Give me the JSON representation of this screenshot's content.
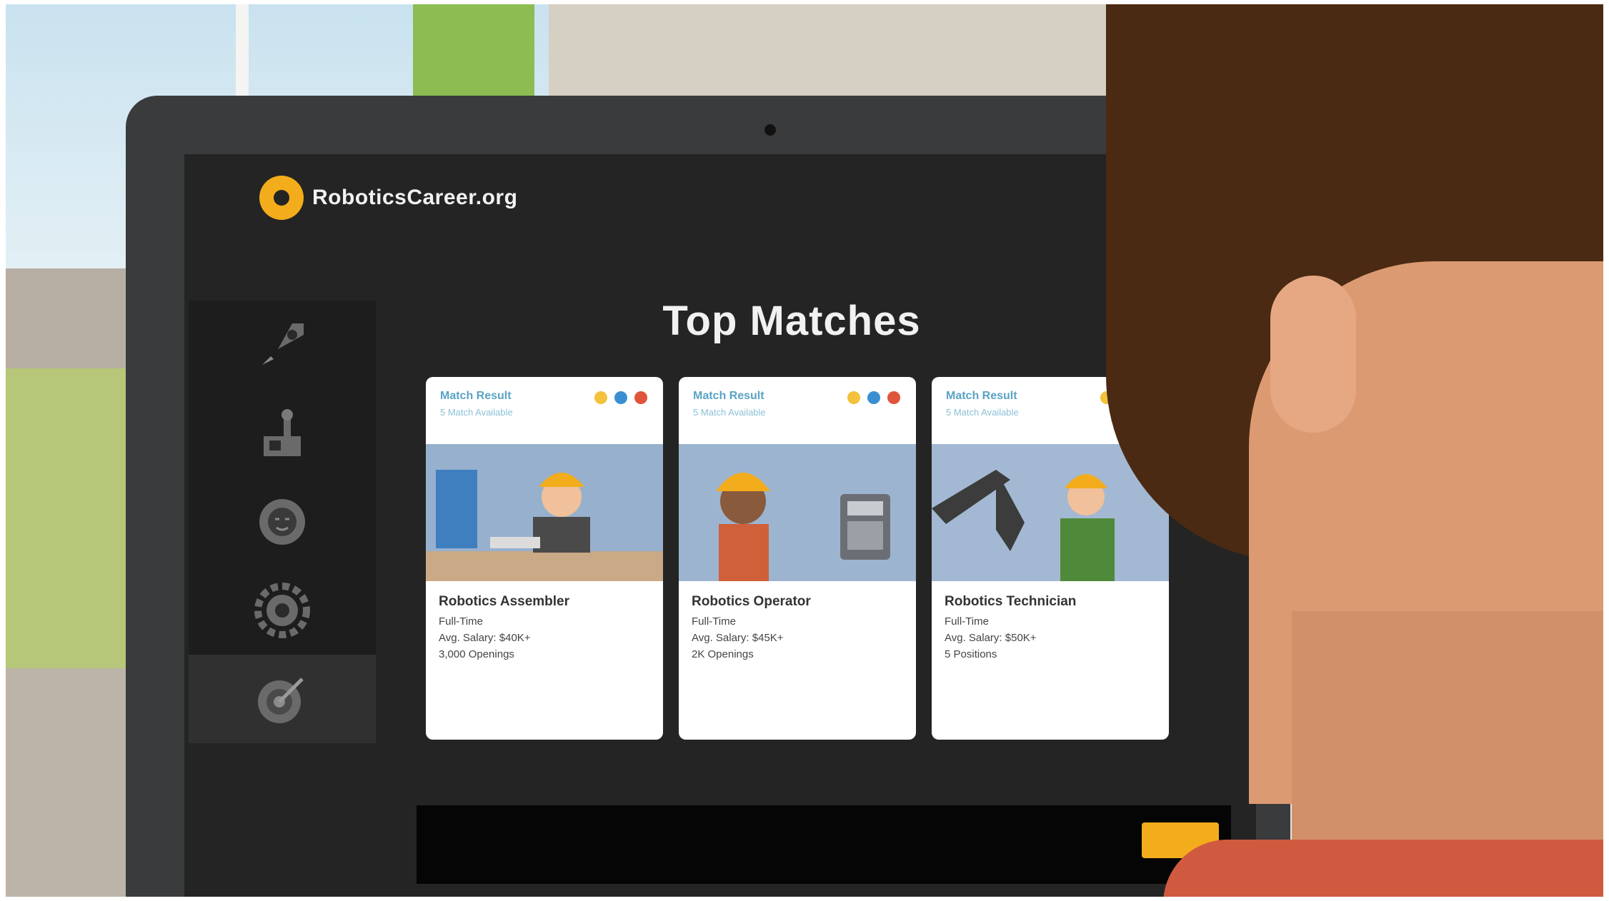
{
  "site": {
    "logo_text": "RoboticsCareer.org"
  },
  "page": {
    "title": "Top Matches"
  },
  "sidebar": {
    "items": [
      {
        "icon": "rocket-icon",
        "active": false
      },
      {
        "icon": "robot-arm-icon",
        "active": false
      },
      {
        "icon": "gear-face-icon",
        "active": false
      },
      {
        "icon": "settings-gear-icon",
        "active": false
      },
      {
        "icon": "target-icon",
        "active": true
      }
    ]
  },
  "cards": [
    {
      "match_label": "Match Result",
      "match_sub": "5 Match Available",
      "job_title": "Robotics Assembler",
      "type": "Full-Time",
      "salary": "Avg. Salary: $40K+",
      "extra": "3,000 Openings"
    },
    {
      "match_label": "Match Result",
      "match_sub": "5 Match Available",
      "job_title": "Robotics Operator",
      "type": "Full-Time",
      "salary": "Avg. Salary: $45K+",
      "extra": "2K Openings"
    },
    {
      "match_label": "Match Result",
      "match_sub": "5 Match Available",
      "job_title": "Robotics Technician",
      "type": "Full-Time",
      "salary": "Avg. Salary: $50K+",
      "extra": "5 Positions"
    }
  ],
  "colors": {
    "accent": "#f3ac1b",
    "dot_yellow": "#f3c13a",
    "dot_blue": "#3a8fd0",
    "dot_red": "#e0543a"
  }
}
